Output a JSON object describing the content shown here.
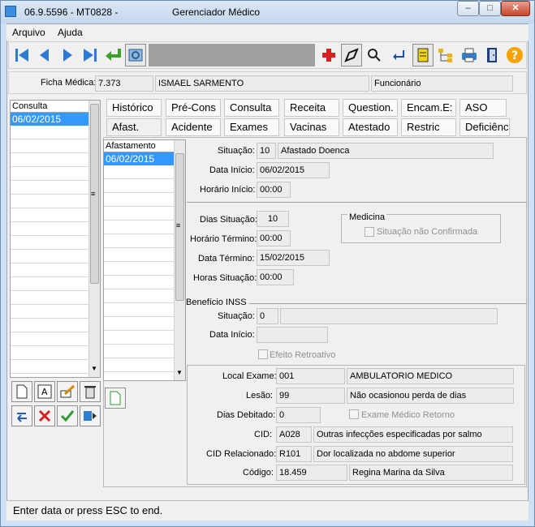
{
  "window": {
    "title_left": "06.9.5596 - MT0828 -",
    "title_right": "Gerenciador Médico",
    "min": "–",
    "max": "□",
    "close": "✕"
  },
  "menu": [
    {
      "label": "Arquivo"
    },
    {
      "label": "Ajuda"
    }
  ],
  "ficha": {
    "label": "Ficha Médica:",
    "number": "7.373",
    "name": "ISMAEL SARMENTO",
    "type": "Funcionário"
  },
  "consulta_list": {
    "header": "Consulta",
    "items": [
      "06/02/2015"
    ]
  },
  "tabs_row1": [
    "Histórico",
    "Pré-Cons",
    "Consulta",
    "Receita",
    "Question.",
    "Encam.E:",
    "ASO"
  ],
  "tabs_row2": [
    "Afast.",
    "Acidente",
    "Exames",
    "Vacinas",
    "Atestado",
    "Restric",
    "Deficiênc"
  ],
  "afast_list": {
    "header": "Afastamento",
    "items": [
      "06/02/2015"
    ]
  },
  "situacao": {
    "label": "Situação:",
    "code": "10",
    "desc": "Afastado Doenca"
  },
  "data_inicio": {
    "label": "Data Início:",
    "value": "06/02/2015"
  },
  "horario_inicio": {
    "label": "Horário Início:",
    "value": "00:00"
  },
  "dias_situacao": {
    "label": "Dias Situação:",
    "value": "10"
  },
  "horario_termino": {
    "label": "Horário Término:",
    "value": "00:00"
  },
  "data_termino": {
    "label": "Data Término:",
    "value": "15/02/2015"
  },
  "horas_situacao": {
    "label": "Horas Situação:",
    "value": "00:00"
  },
  "medicina": {
    "title": "Medicina",
    "check_label": "Situação não Confirmada"
  },
  "inss": {
    "title": "Benefício INSS",
    "situacao_label": "Situação:",
    "situacao_code": "0",
    "situacao_desc": "",
    "data_inicio_label": "Data Início:",
    "data_inicio_value": "",
    "efeito_label": "Efeito Retroativo"
  },
  "exame": {
    "local_label": "Local Exame:",
    "local_code": "001",
    "local_desc": "AMBULATORIO MEDICO",
    "lesao_label": "Lesão:",
    "lesao_code": "99",
    "lesao_desc": "Não ocasionou perda de dias",
    "dias_label": "Dias Debitado:",
    "dias_value": "0",
    "retorno_label": "Exame Médico Retorno",
    "cid_label": "CID:",
    "cid_code": "A028",
    "cid_desc": "Outras infecções especificadas por salmo",
    "cidrel_label": "CID Relacionado:",
    "cidrel_code": "R101",
    "cidrel_desc": "Dor localizada no abdome superior",
    "codigo_label": "Código:",
    "codigo_value": "18.459",
    "codigo_name": "Regina Marina da Silva"
  },
  "status": "Enter data or press ESC to end."
}
